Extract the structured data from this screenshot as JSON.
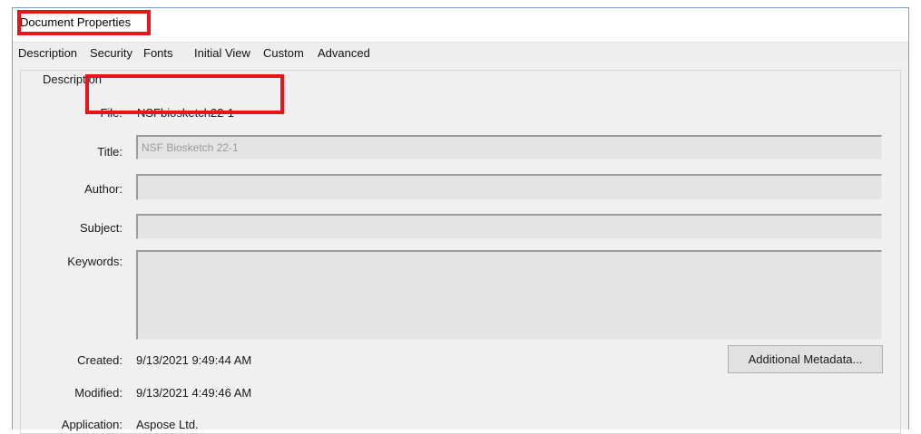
{
  "window": {
    "title": "Document Properties"
  },
  "tabs": [
    {
      "label": "Description"
    },
    {
      "label": "Security"
    },
    {
      "label": "Fonts"
    },
    {
      "label": "Initial View"
    },
    {
      "label": "Custom"
    },
    {
      "label": "Advanced"
    }
  ],
  "description": {
    "group_label": "Description",
    "file": {
      "label": "File:",
      "value": "NSFbiosketch22-1"
    },
    "title": {
      "label": "Title:",
      "value": "NSF Biosketch 22-1"
    },
    "author": {
      "label": "Author:",
      "value": ""
    },
    "subject": {
      "label": "Subject:",
      "value": ""
    },
    "keywords": {
      "label": "Keywords:",
      "value": ""
    },
    "created": {
      "label": "Created:",
      "value": "9/13/2021 9:49:44 AM"
    },
    "modified": {
      "label": "Modified:",
      "value": "9/13/2021 4:49:46 AM"
    },
    "application": {
      "label": "Application:",
      "value": "Aspose Ltd."
    },
    "additional_metadata_button": "Additional Metadata..."
  },
  "colors": {
    "highlight": "#e8141b",
    "window_border": "#7a9fc9"
  }
}
